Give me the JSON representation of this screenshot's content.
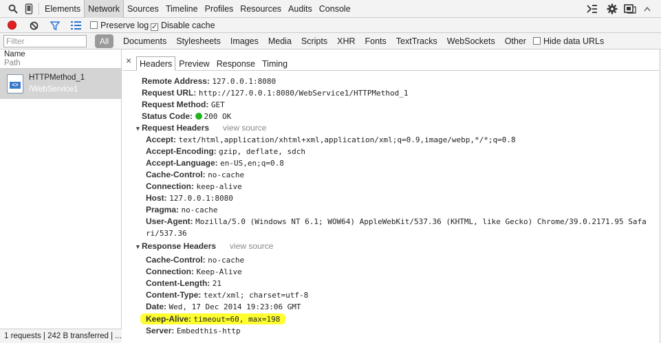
{
  "topbar": {
    "tabs": [
      "Elements",
      "Network",
      "Sources",
      "Timeline",
      "Profiles",
      "Resources",
      "Audits",
      "Console"
    ],
    "active_tab": "Network"
  },
  "toolbar2": {
    "preserve_log": "Preserve log",
    "disable_cache": "Disable cache",
    "disable_cache_checked": true
  },
  "filterbar": {
    "placeholder": "Filter",
    "all": "All",
    "types": [
      "Documents",
      "Stylesheets",
      "Images",
      "Media",
      "Scripts",
      "XHR",
      "Fonts",
      "TextTracks",
      "WebSockets",
      "Other"
    ],
    "hide_data_urls": "Hide data URLs"
  },
  "requests": {
    "col_name": "Name",
    "col_path": "Path",
    "items": [
      {
        "name": "HTTPMethod_1",
        "path": "/WebService1"
      }
    ],
    "status": "1 requests | 242 B transferred | ..."
  },
  "detail": {
    "tabs": [
      "Headers",
      "Preview",
      "Response",
      "Timing"
    ],
    "active_tab": "Headers",
    "general": {
      "remote_address_k": "Remote Address:",
      "remote_address_v": "127.0.0.1:8080",
      "request_url_k": "Request URL:",
      "request_url_v": "http://127.0.0.1:8080/WebService1/HTTPMethod_1",
      "request_method_k": "Request Method:",
      "request_method_v": "GET",
      "status_code_k": "Status Code:",
      "status_code_v": "200 OK",
      "status_color": "#21b321"
    },
    "request_headers": {
      "title": "Request Headers",
      "view_source": "view source",
      "rows": [
        {
          "k": "Accept:",
          "v": "text/html,application/xhtml+xml,application/xml;q=0.9,image/webp,*/*;q=0.8"
        },
        {
          "k": "Accept-Encoding:",
          "v": "gzip, deflate, sdch"
        },
        {
          "k": "Accept-Language:",
          "v": "en-US,en;q=0.8"
        },
        {
          "k": "Cache-Control:",
          "v": "no-cache"
        },
        {
          "k": "Connection:",
          "v": "keep-alive"
        },
        {
          "k": "Host:",
          "v": "127.0.0.1:8080"
        },
        {
          "k": "Pragma:",
          "v": "no-cache"
        },
        {
          "k": "User-Agent:",
          "v": "Mozilla/5.0 (Windows NT 6.1; WOW64) AppleWebKit/537.36 (KHTML, like Gecko) Chrome/39.0.2171.95 Safa"
        }
      ],
      "user_agent_wrap": "ri/537.36"
    },
    "response_headers": {
      "title": "Response Headers",
      "view_source": "view source",
      "rows": [
        {
          "k": "Cache-Control:",
          "v": "no-cache"
        },
        {
          "k": "Connection:",
          "v": "Keep-Alive"
        },
        {
          "k": "Content-Length:",
          "v": "21"
        },
        {
          "k": "Content-Type:",
          "v": "text/xml; charset=utf-8"
        },
        {
          "k": "Date:",
          "v": "Wed, 17 Dec 2014 19:23:06 GMT"
        },
        {
          "k": "Keep-Alive:",
          "v": "timeout=60, max=198"
        },
        {
          "k": "Server:",
          "v": "Embedthis-http"
        }
      ],
      "highlight_color": "#ffff30"
    }
  }
}
